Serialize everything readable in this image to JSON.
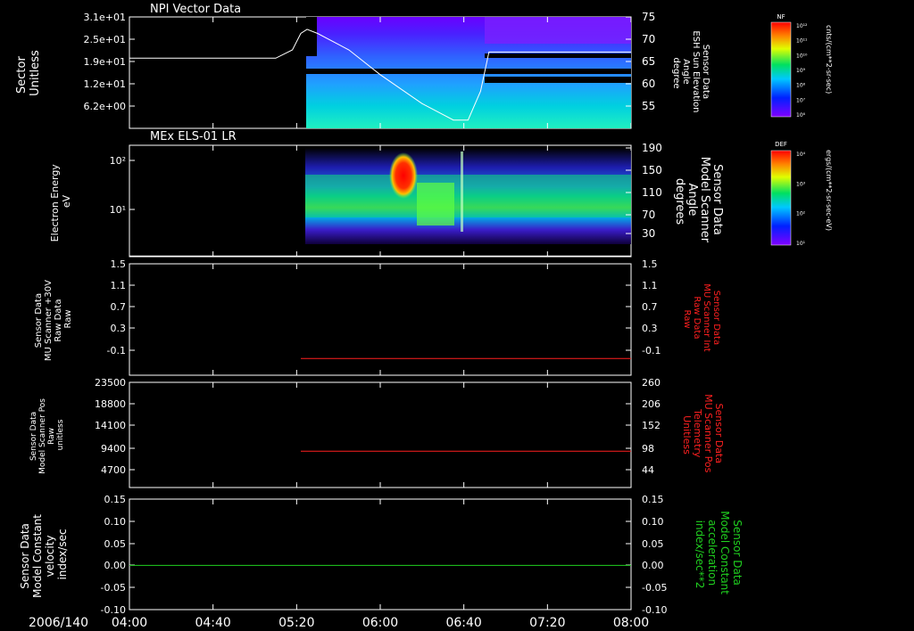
{
  "time_axis": {
    "date_label": "2006/140",
    "ticks": [
      "04:00",
      "04:40",
      "05:20",
      "06:00",
      "06:40",
      "07:20",
      "08:00"
    ]
  },
  "chart_data": [
    {
      "type": "heatmap",
      "title": "NPI Vector Data",
      "ylabel_lines": [
        "Sector",
        "Unitless"
      ],
      "left_ticks": [
        "3.1e+01",
        "2.5e+01",
        "1.9e+01",
        "1.2e+01",
        "6.2e+00"
      ],
      "right_label_lines": [
        "Sensor Data",
        "ESH Sun Elevation",
        "Angle",
        "degree"
      ],
      "right_ticks": [
        "75",
        "70",
        "65",
        "60",
        "55"
      ],
      "right_ylim": [
        48,
        75
      ],
      "data_start": "05:22",
      "line_series": {
        "name": "ESH Sun Elevation Angle",
        "x": [
          "04:00",
          "05:10",
          "05:18",
          "05:22",
          "05:25",
          "05:30",
          "05:45",
          "06:00",
          "06:20",
          "06:35",
          "06:42",
          "06:48",
          "06:52",
          "08:00"
        ],
        "y": [
          65,
          65,
          67,
          71,
          72,
          71,
          67,
          61,
          54,
          50,
          50,
          57,
          66.5,
          66.5
        ]
      },
      "colorbar": {
        "label": "NF",
        "unit": "cnts/(cm**2-sr-sec)",
        "ticks": [
          "10¹²",
          "10¹¹",
          "10¹⁰",
          "10⁹",
          "10⁸",
          "10⁷",
          "10⁶"
        ]
      }
    },
    {
      "type": "heatmap",
      "title": "MEx ELS-01 LR",
      "ylabel_lines": [
        "Electron Energy",
        "eV"
      ],
      "left_ticks": [
        "10²",
        "10¹"
      ],
      "right_label_lines": [
        "Sensor Data",
        "Model Scanner",
        "Angle",
        "degrees"
      ],
      "right_ticks": [
        "190",
        "150",
        "110",
        "70",
        "30"
      ],
      "right_ylim": [
        10,
        190
      ],
      "data_start": "05:22",
      "line_series": {
        "name": "Model Scanner Angle",
        "x": [
          "04:00",
          "08:00"
        ],
        "y": [
          11,
          11
        ]
      },
      "colorbar": {
        "label": "DEF",
        "unit": "ergs/(cm**2-sr-sec-eV)",
        "ticks": [
          "10⁴",
          "10³",
          "10²",
          "10¹"
        ]
      }
    },
    {
      "type": "line",
      "ylabel_lines": [
        "Sensor Data",
        "MU Scanner +30V",
        "Raw Data",
        "Raw"
      ],
      "left_ticks": [
        "1.5",
        "1.1",
        "0.7",
        "0.3",
        "-0.1"
      ],
      "ylim": [
        -0.3,
        1.5
      ],
      "right_label_lines": [
        "Sensor Data",
        "MU Scanner Int",
        "Raw Data",
        "Raw"
      ],
      "right_ticks": [
        "1.5",
        "1.1",
        "0.7",
        "0.3",
        "-0.1"
      ],
      "series": [
        {
          "x": [
            "05:22",
            "08:00"
          ],
          "y": [
            -0.03,
            -0.03
          ],
          "color": "#ff2020"
        }
      ]
    },
    {
      "type": "line",
      "ylabel_lines": [
        "Sensor Data",
        "Model Scanner Pos",
        "Raw",
        "unitless"
      ],
      "left_ticks": [
        "23500",
        "18800",
        "14100",
        "9400",
        "4700"
      ],
      "ylim": [
        0,
        23500
      ],
      "right_label_lines": [
        "Sensor Data",
        "MU Scanner Pos",
        "Telemetry",
        "Unitless"
      ],
      "right_ticks": [
        "260",
        "206",
        "152",
        "98",
        "44"
      ],
      "series": [
        {
          "x": [
            "05:22",
            "08:00"
          ],
          "y": [
            8100,
            8100
          ],
          "color": "#ff2020"
        }
      ]
    },
    {
      "type": "line",
      "ylabel_lines": [
        "Sensor Data",
        "Model Constant",
        "velocity",
        "index/sec"
      ],
      "left_ticks": [
        "0.15",
        "0.10",
        "0.05",
        "0.00",
        "-0.05",
        "-0.10"
      ],
      "ylim": [
        -0.1,
        0.15
      ],
      "right_label_lines": [
        "Sensor Data",
        "Model Constant",
        "acceleration",
        "index/sec**2"
      ],
      "right_ticks": [
        "0.15",
        "0.10",
        "0.05",
        "0.00",
        "-0.05",
        "-0.10"
      ],
      "series": [
        {
          "x": [
            "04:00",
            "08:00"
          ],
          "y": [
            0.0,
            0.0
          ],
          "color": "#20d020"
        }
      ]
    }
  ],
  "colors": {
    "axis": "#ffffff",
    "red_label": "#ff2020",
    "green_label": "#20d020"
  }
}
